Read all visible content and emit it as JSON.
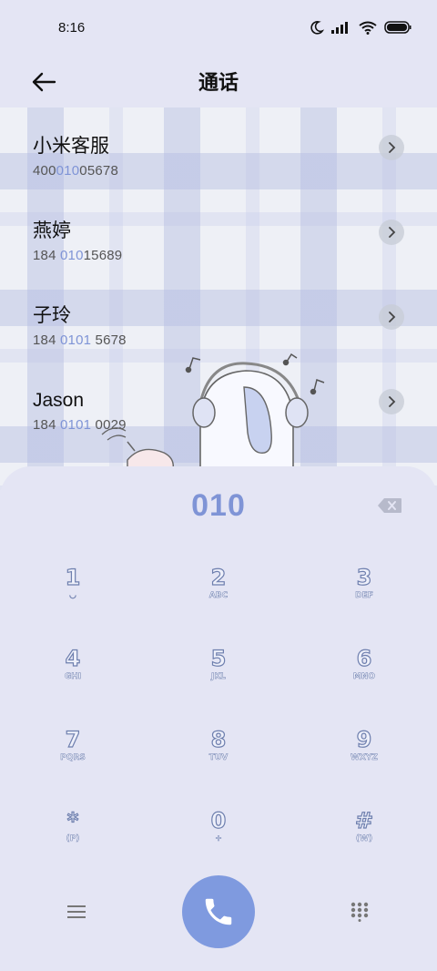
{
  "status_bar": {
    "time": "8:16",
    "icons": [
      "moon-icon",
      "signal-icon",
      "wifi-icon",
      "battery-icon"
    ]
  },
  "header": {
    "title": "通话",
    "back_icon": "arrow-left-icon"
  },
  "contacts": [
    {
      "name": "小米客服",
      "number_pre": "400",
      "number_hl": "010",
      "number_post": "05678"
    },
    {
      "name": "燕婷",
      "number_pre": "184 ",
      "number_hl": "010",
      "number_post": "15689"
    },
    {
      "name": "子玲",
      "number_pre": "184 ",
      "number_hl": "0101",
      "number_post": " 5678"
    },
    {
      "name": "Jason",
      "number_pre": "184 ",
      "number_hl": "0101",
      "number_post": " 0029"
    }
  ],
  "dialer": {
    "input": "010",
    "keys": [
      {
        "main": "1",
        "sub": "◡"
      },
      {
        "main": "2",
        "sub": "ABC"
      },
      {
        "main": "3",
        "sub": "DEF"
      },
      {
        "main": "4",
        "sub": "GHI"
      },
      {
        "main": "5",
        "sub": "JKL"
      },
      {
        "main": "6",
        "sub": "MNO"
      },
      {
        "main": "7",
        "sub": "PQRS"
      },
      {
        "main": "8",
        "sub": "TUV"
      },
      {
        "main": "9",
        "sub": "WXYZ"
      },
      {
        "main": "*",
        "sub": "(P)"
      },
      {
        "main": "0",
        "sub": "+"
      },
      {
        "main": "#",
        "sub": "(W)"
      }
    ]
  },
  "colors": {
    "accent": "#7f94d6",
    "call_button": "#7f9adf",
    "background": "#e4e5f4"
  }
}
